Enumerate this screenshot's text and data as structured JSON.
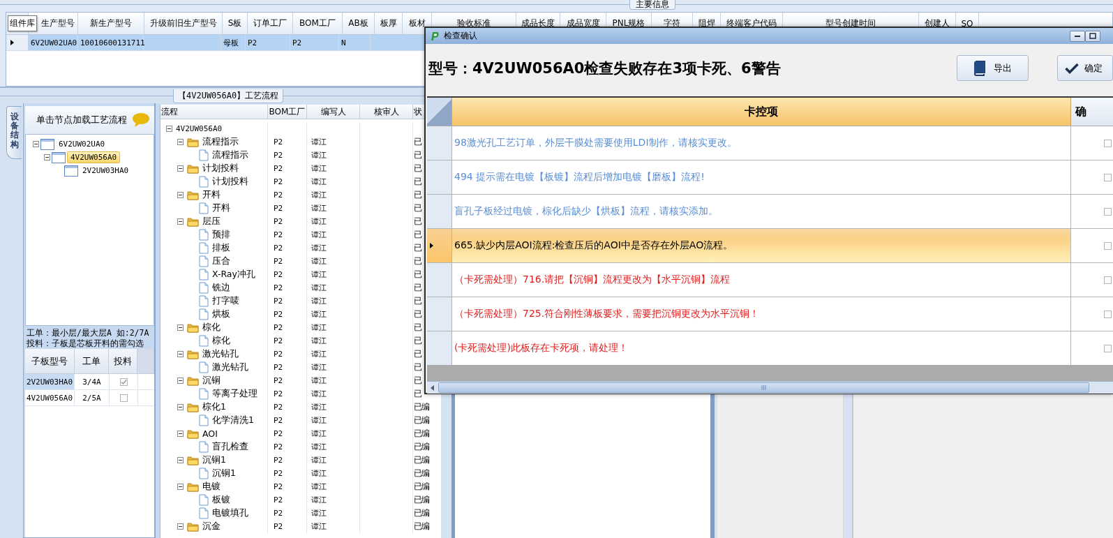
{
  "top_panel": {
    "group_title": "主要信息",
    "tooltip": "组件库",
    "columns": [
      "生产型号",
      "新生产型号",
      "升级前旧生产型号",
      "S板",
      "订单工厂",
      "BOM工厂",
      "AB板",
      "板厚",
      "板材",
      "验收标准",
      "成品长度",
      "成品宽度",
      "PNL规格",
      "字符",
      "阻焊",
      "终端客户代码",
      "型号创建时间",
      "创建人",
      "SO"
    ],
    "rows": [
      {
        "selected": true,
        "cells": [
          "6V2UW02UA0",
          "10010600131711",
          null,
          "母板",
          "P2",
          "P2",
          "N"
        ]
      }
    ]
  },
  "process_panel": {
    "group_title": "【4V2UW056A0】工艺流程",
    "side_tab": "设备结构",
    "structure": {
      "hint": "单击节点加载工艺流程",
      "tree": [
        {
          "label": "6V2UW02UA0",
          "expanded": true,
          "selected": false,
          "children": [
            {
              "label": "4V2UW056A0",
              "expanded": true,
              "selected": true,
              "children": [
                {
                  "label": "2V2UW03HA0",
                  "selected": false
                }
              ]
            }
          ]
        }
      ],
      "note_lines": [
        "工单：最小层/最大层A 如:2/7A",
        "投料：子板是芯板开料的需勾选"
      ],
      "sub_boards": {
        "columns": [
          "子板型号",
          "工单",
          "投料"
        ],
        "rows": [
          {
            "board": "2V2UW03HA0",
            "order": "3/4A",
            "feed_checked": true,
            "selected": true
          },
          {
            "board": "4V2UW056A0",
            "order": "2/5A",
            "feed_checked": false,
            "selected": false
          }
        ]
      }
    },
    "flow": {
      "columns": [
        "流程",
        "BOM工厂",
        "编写人",
        "核审人",
        "状"
      ],
      "tree": [
        {
          "label": "4V2UW056A0",
          "kind": "root",
          "expanded": true,
          "children": [
            {
              "label": "流程指示",
              "kind": "group",
              "expanded": true,
              "bom": "P2",
              "writer": "谭江",
              "status": "已",
              "children": [
                {
                  "label": "流程指示",
                  "kind": "step",
                  "bom": "P2",
                  "writer": "谭江",
                  "status": "已"
                }
              ]
            },
            {
              "label": "计划投料",
              "kind": "group",
              "expanded": true,
              "bom": "P2",
              "writer": "谭江",
              "status": "已",
              "children": [
                {
                  "label": "计划投料",
                  "kind": "step",
                  "bom": "P2",
                  "writer": "谭江",
                  "status": "已"
                }
              ]
            },
            {
              "label": "开料",
              "kind": "group",
              "expanded": true,
              "bom": "P2",
              "writer": "谭江",
              "status": "已",
              "children": [
                {
                  "label": "开料",
                  "kind": "step",
                  "bom": "P2",
                  "writer": "谭江",
                  "status": "已"
                }
              ]
            },
            {
              "label": "层压",
              "kind": "group",
              "expanded": true,
              "bom": "P2",
              "writer": "谭江",
              "status": "已",
              "children": [
                {
                  "label": "预排",
                  "kind": "step",
                  "bom": "P2",
                  "writer": "谭江",
                  "status": "已"
                },
                {
                  "label": "排板",
                  "kind": "step",
                  "bom": "P2",
                  "writer": "谭江",
                  "status": "已"
                },
                {
                  "label": "压合",
                  "kind": "step",
                  "bom": "P2",
                  "writer": "谭江",
                  "status": "已"
                },
                {
                  "label": "X-Ray冲孔",
                  "kind": "step",
                  "bom": "P2",
                  "writer": "谭江",
                  "status": "已"
                },
                {
                  "label": "铣边",
                  "kind": "step",
                  "bom": "P2",
                  "writer": "谭江",
                  "status": "已"
                },
                {
                  "label": "打字唛",
                  "kind": "step",
                  "bom": "P2",
                  "writer": "谭江",
                  "status": "已"
                },
                {
                  "label": "烘板",
                  "kind": "step",
                  "bom": "P2",
                  "writer": "谭江",
                  "status": "已"
                }
              ]
            },
            {
              "label": "棕化",
              "kind": "group",
              "expanded": true,
              "bom": "P2",
              "writer": "谭江",
              "status": "已",
              "children": [
                {
                  "label": "棕化",
                  "kind": "step",
                  "bom": "P2",
                  "writer": "谭江",
                  "status": "已"
                }
              ]
            },
            {
              "label": "激光钻孔",
              "kind": "group",
              "expanded": true,
              "bom": "P2",
              "writer": "谭江",
              "status": "已",
              "children": [
                {
                  "label": "激光钻孔",
                  "kind": "step",
                  "bom": "P2",
                  "writer": "谭江",
                  "status": "已"
                }
              ]
            },
            {
              "label": "沉铜",
              "kind": "group",
              "expanded": true,
              "bom": "P2",
              "writer": "谭江",
              "status": "已",
              "children": [
                {
                  "label": "等离子处理",
                  "kind": "step",
                  "bom": "P2",
                  "writer": "谭江",
                  "status": "已"
                }
              ]
            },
            {
              "label": "棕化1",
              "kind": "group",
              "expanded": true,
              "bom": "P2",
              "writer": "谭江",
              "status": "已编",
              "children": [
                {
                  "label": "化学清洗1",
                  "kind": "step",
                  "bom": "P2",
                  "writer": "谭江",
                  "status": "已编"
                }
              ]
            },
            {
              "label": "AOI",
              "kind": "group",
              "expanded": true,
              "bom": "P2",
              "writer": "谭江",
              "status": "已编",
              "children": [
                {
                  "label": "盲孔检查",
                  "kind": "step",
                  "bom": "P2",
                  "writer": "谭江",
                  "status": "已编"
                }
              ]
            },
            {
              "label": "沉铜1",
              "kind": "group",
              "expanded": true,
              "bom": "P2",
              "writer": "谭江",
              "status": "已编",
              "children": [
                {
                  "label": "沉铜1",
                  "kind": "step",
                  "bom": "P2",
                  "writer": "谭江",
                  "status": "已编"
                }
              ]
            },
            {
              "label": "电镀",
              "kind": "group",
              "expanded": true,
              "bom": "P2",
              "writer": "谭江",
              "status": "已编",
              "children": [
                {
                  "label": "板镀",
                  "kind": "step",
                  "bom": "P2",
                  "writer": "谭江",
                  "status": "已编"
                },
                {
                  "label": "电镀填孔",
                  "kind": "step",
                  "bom": "P2",
                  "writer": "谭江",
                  "status": "已编"
                }
              ]
            },
            {
              "label": "沉金",
              "kind": "group",
              "expanded": true,
              "bom": "P2",
              "writer": "谭江",
              "status": "已编"
            }
          ]
        }
      ]
    }
  },
  "dialog": {
    "title": "检查确认",
    "heading": "型号：4V2UW056A0检查失败存在3项卡死、6警告",
    "buttons": [
      {
        "label": "导出",
        "kind": "export"
      },
      {
        "label": "确定",
        "kind": "confirm"
      }
    ],
    "columns": [
      "卡控项",
      "确"
    ],
    "rows": [
      {
        "text": "98激光孔工艺订单，外层干膜处需要使用LDI制作，请核实更改。",
        "kind": "warning",
        "selected": false,
        "checked": false
      },
      {
        "text": "494 提示需在电镀【板镀】流程后增加电镀【磨板】流程!",
        "kind": "warning",
        "selected": false,
        "checked": false
      },
      {
        "text": "盲孔子板经过电镀，棕化后缺少【烘板】流程，请核实添加。",
        "kind": "warning",
        "selected": false,
        "checked": false
      },
      {
        "text": "665.缺少内层AOI流程:检查压后的AOI中是否存在外层AO流程。",
        "kind": "warning",
        "selected": true,
        "checked": false
      },
      {
        "text": "（卡死需处理）716.请把【沉铜】流程更改为【水平沉铜】流程",
        "kind": "blocking",
        "selected": false,
        "checked": false
      },
      {
        "text": "（卡死需处理）725.符合刚性薄板要求，需要把沉铜更改为水平沉铜！",
        "kind": "blocking",
        "selected": false,
        "checked": false
      },
      {
        "text": "(卡死需处理)此板存在卡死项，请处理！",
        "kind": "blocking",
        "selected": false,
        "checked": false
      }
    ]
  }
}
